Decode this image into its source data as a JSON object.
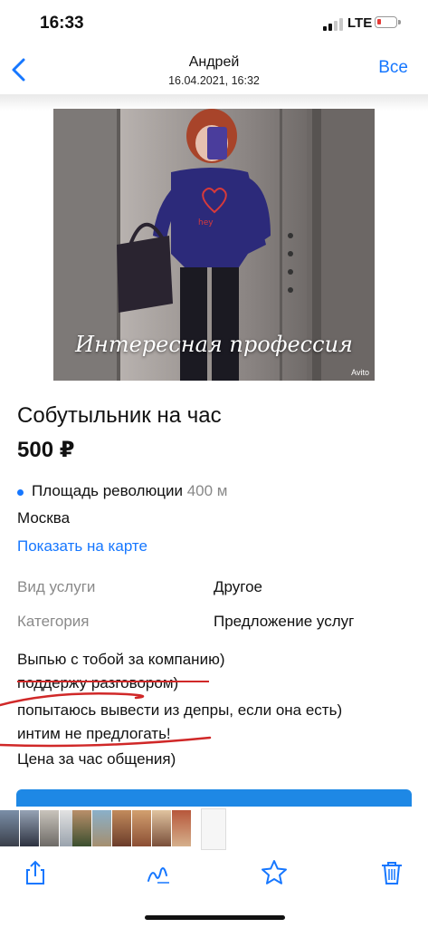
{
  "status_bar": {
    "time": "16:33",
    "network": "LTE",
    "signal_bars": 2,
    "battery_level": "low"
  },
  "nav": {
    "back_icon": "chevron-left-icon",
    "title": "Андрей",
    "subtitle": "16.04.2021, 16:32",
    "all_label": "Все"
  },
  "listing": {
    "photo_caption": "Интересная профессия",
    "photo_watermark": "Avito",
    "title": "Собутыльник на час",
    "price": "500 ₽",
    "metro": "Площадь революции",
    "metro_distance": "400 м",
    "city": "Москва",
    "map_link": "Показать на карте",
    "params": [
      {
        "label": "Вид услуги",
        "value": "Другое"
      },
      {
        "label": "Категория",
        "value": "Предложение услуг"
      }
    ],
    "description": [
      "Выпью с тобой за компанию)",
      "поддержу разговором)",
      "попытаюсь вывести из депры, если она есть)",
      "интим не предлогать!",
      "Цена за час общения)"
    ]
  },
  "colors": {
    "accent": "#1677ff",
    "button_blue": "#1e88e5",
    "annotation_red": "#d02828",
    "muted_text": "#8a8a8a"
  },
  "toolbar": {
    "share_icon": "share-icon",
    "markup_icon": "markup-icon",
    "favorite_icon": "star-icon",
    "delete_icon": "trash-icon"
  }
}
